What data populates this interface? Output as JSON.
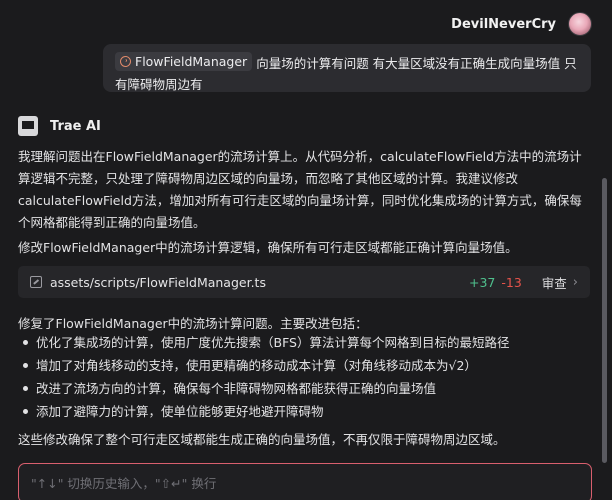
{
  "user": {
    "name": "DevilNeverCry"
  },
  "user_message": {
    "file_chip": "FlowFieldManager",
    "text": "向量场的计算有问题 有大量区域没有正确生成向量场值 只有障碍物周边有"
  },
  "assistant": {
    "name": "Trae AI",
    "paragraph1": "我理解问题出在FlowFieldManager的流场计算上。从代码分析，calculateFlowField方法中的流场计算逻辑不完整，只处理了障碍物周边区域的向量场，而忽略了其他区域的计算。我建议修改calculateFlowField方法，增加对所有可行走区域的向量场计算，同时优化集成场的计算方式，确保每个网格都能得到正确的向量场值。",
    "paragraph2": "修改FlowFieldManager中的流场计算逻辑，确保所有可行走区域都能正确计算向量场值。",
    "file_change": {
      "path": "assets/scripts/FlowFieldManager.ts",
      "additions": "+37",
      "deletions": "-13",
      "review_label": "审查"
    },
    "paragraph3": "修复了FlowFieldManager中的流场计算问题。主要改进包括：",
    "bullets": [
      "优化了集成场的计算，使用广度优先搜索（BFS）算法计算每个网格到目标的最短路径",
      "增加了对角线移动的支持，使用更精确的移动成本计算（对角线移动成本为√2）",
      "改进了流场方向的计算，确保每个非障碍物网格都能获得正确的向量场值",
      "添加了避障力的计算，使单位能够更好地避开障碍物"
    ],
    "paragraph4": "这些修改确保了整个可行走区域都能生成正确的向量场值，不再仅限于障碍物周边区域。"
  },
  "input": {
    "placeholder": "\"↑↓\" 切换历史输入，\"⇧↵\" 换行"
  },
  "colors": {
    "background": "#1b1b1d",
    "additions": "#4fc08d",
    "deletions": "#e5534b",
    "input_border": "#d95f6e"
  }
}
